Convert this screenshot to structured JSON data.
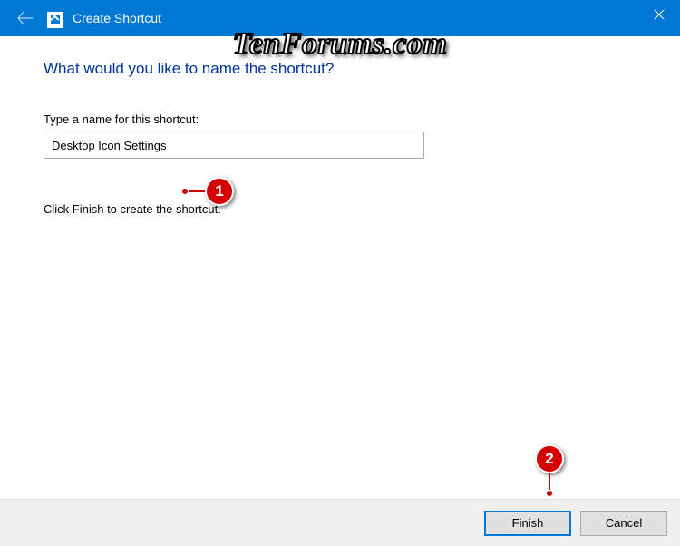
{
  "titlebar": {
    "title": "Create Shortcut"
  },
  "content": {
    "heading": "What would you like to name the shortcut?",
    "field_label": "Type a name for this shortcut:",
    "input_value": "Desktop Icon Settings",
    "instruction": "Click Finish to create the shortcut."
  },
  "footer": {
    "finish_label": "Finish",
    "cancel_label": "Cancel"
  },
  "annotations": {
    "a1": "1",
    "a2": "2"
  },
  "watermark": "TenForums.com"
}
